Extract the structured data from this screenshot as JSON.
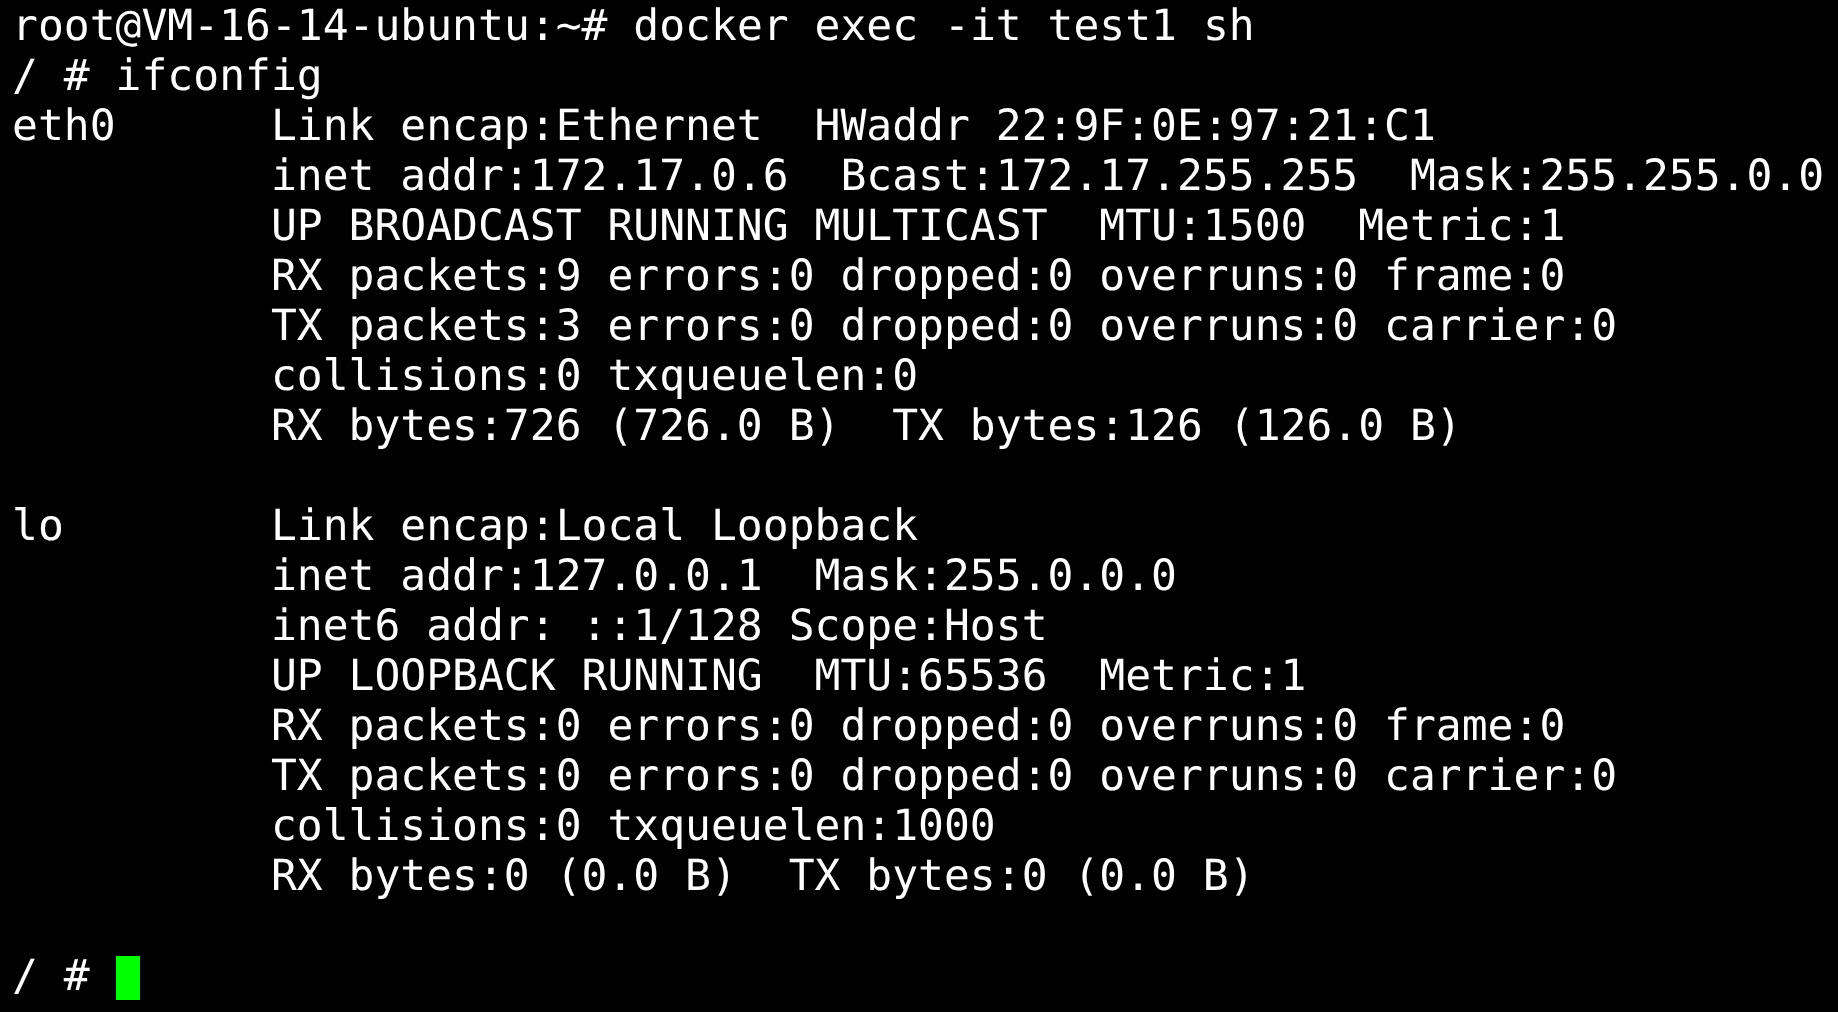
{
  "commands": [
    {
      "prompt": "root@VM-16-14-ubuntu:~#",
      "command": "docker exec -it test1 sh"
    },
    {
      "prompt": "/ #",
      "command": "ifconfig"
    }
  ],
  "interfaces": [
    {
      "name": "eth0",
      "lines": [
        "Link encap:Ethernet  HWaddr 22:9F:0E:97:21:C1",
        "inet addr:172.17.0.6  Bcast:172.17.255.255  Mask:255.255.0.0",
        "UP BROADCAST RUNNING MULTICAST  MTU:1500  Metric:1",
        "RX packets:9 errors:0 dropped:0 overruns:0 frame:0",
        "TX packets:3 errors:0 dropped:0 overruns:0 carrier:0",
        "collisions:0 txqueuelen:0",
        "RX bytes:726 (726.0 B)  TX bytes:126 (126.0 B)"
      ]
    },
    {
      "name": "lo",
      "lines": [
        "Link encap:Local Loopback",
        "inet addr:127.0.0.1  Mask:255.0.0.0",
        "inet6 addr: ::1/128 Scope:Host",
        "UP LOOPBACK RUNNING  MTU:65536  Metric:1",
        "RX packets:0 errors:0 dropped:0 overruns:0 frame:0",
        "TX packets:0 errors:0 dropped:0 overruns:0 carrier:0",
        "collisions:0 txqueuelen:1000",
        "RX bytes:0 (0.0 B)  TX bytes:0 (0.0 B)"
      ]
    }
  ],
  "current_prompt": "/ #"
}
